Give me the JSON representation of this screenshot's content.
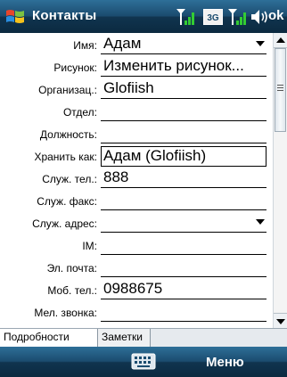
{
  "titlebar": {
    "title": "Контакты",
    "tray_3g": "3G",
    "ok": "ok",
    "icons": [
      "windows-start-icon",
      "signal-antenna-icon",
      "3g-icon",
      "signal-antenna-icon",
      "speaker-icon"
    ]
  },
  "form": {
    "rows": [
      {
        "label": "Имя:",
        "value": "Адам"
      },
      {
        "label": "Рисунок:",
        "value": "Изменить рисунок..."
      },
      {
        "label": "Организац.:",
        "value": "Glofiish"
      },
      {
        "label": "Отдел:",
        "value": ""
      },
      {
        "label": "Должность:",
        "value": ""
      },
      {
        "label": "Хранить как:",
        "value": "Адам (Glofiish)"
      },
      {
        "label": "Служ. тел.:",
        "value": "888"
      },
      {
        "label": "Служ. факс:",
        "value": ""
      },
      {
        "label": "Служ. адрес:",
        "value": ""
      },
      {
        "label": "IM:",
        "value": ""
      },
      {
        "label": "Эл. почта:",
        "value": ""
      },
      {
        "label": "Моб. тел.:",
        "value": "0988675"
      },
      {
        "label": "Мел. звонка:",
        "value": ""
      }
    ]
  },
  "tabs": {
    "details": "Подробности",
    "notes": "Заметки"
  },
  "softkeys": {
    "menu": "Меню"
  },
  "colors": {
    "bar_dark": "#0b2a40",
    "bar_light": "#2e6f98",
    "signal_green": "#33cc33"
  }
}
